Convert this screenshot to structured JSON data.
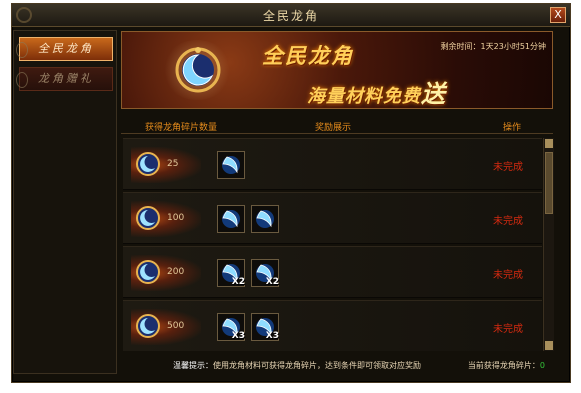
{
  "window": {
    "title": "全民龙角",
    "close_label": "X"
  },
  "sidebar": {
    "items": [
      {
        "label": "全民龙角"
      },
      {
        "label": "龙角赠礼"
      }
    ]
  },
  "banner": {
    "title": "全民龙角",
    "subtitle_main": "海量材料免费",
    "subtitle_emph": "送",
    "countdown": "剩余时间：1天23小时51分钟"
  },
  "table": {
    "headers": [
      "获得龙角碎片数量",
      "奖励展示",
      "操作"
    ],
    "rows": [
      {
        "count": "25",
        "rewards": [
          {
            "icon": "dragon-horn-icon",
            "qty": ""
          }
        ],
        "status": "未完成"
      },
      {
        "count": "100",
        "rewards": [
          {
            "icon": "dragon-horn-icon",
            "qty": ""
          },
          {
            "icon": "dragon-horn-icon",
            "qty": ""
          }
        ],
        "status": "未完成"
      },
      {
        "count": "200",
        "rewards": [
          {
            "icon": "dragon-horn-icon",
            "qty": "X2"
          },
          {
            "icon": "dragon-horn-icon",
            "qty": "X2"
          }
        ],
        "status": "未完成"
      },
      {
        "count": "500",
        "rewards": [
          {
            "icon": "dragon-horn-icon",
            "qty": "X3"
          },
          {
            "icon": "dragon-horn-icon",
            "qty": "X3"
          }
        ],
        "status": "未完成"
      }
    ]
  },
  "footer": {
    "tip_label": "温馨提示：",
    "tip_text": "使用龙角材料可获得龙角碎片，达到条件即可领取对应奖励",
    "owned_label": "当前获得龙角碎片：",
    "owned_value": "0"
  },
  "colors": {
    "accent": "#e38a1c",
    "status": "#d52a10",
    "banner_text": "#ffcf5a"
  }
}
